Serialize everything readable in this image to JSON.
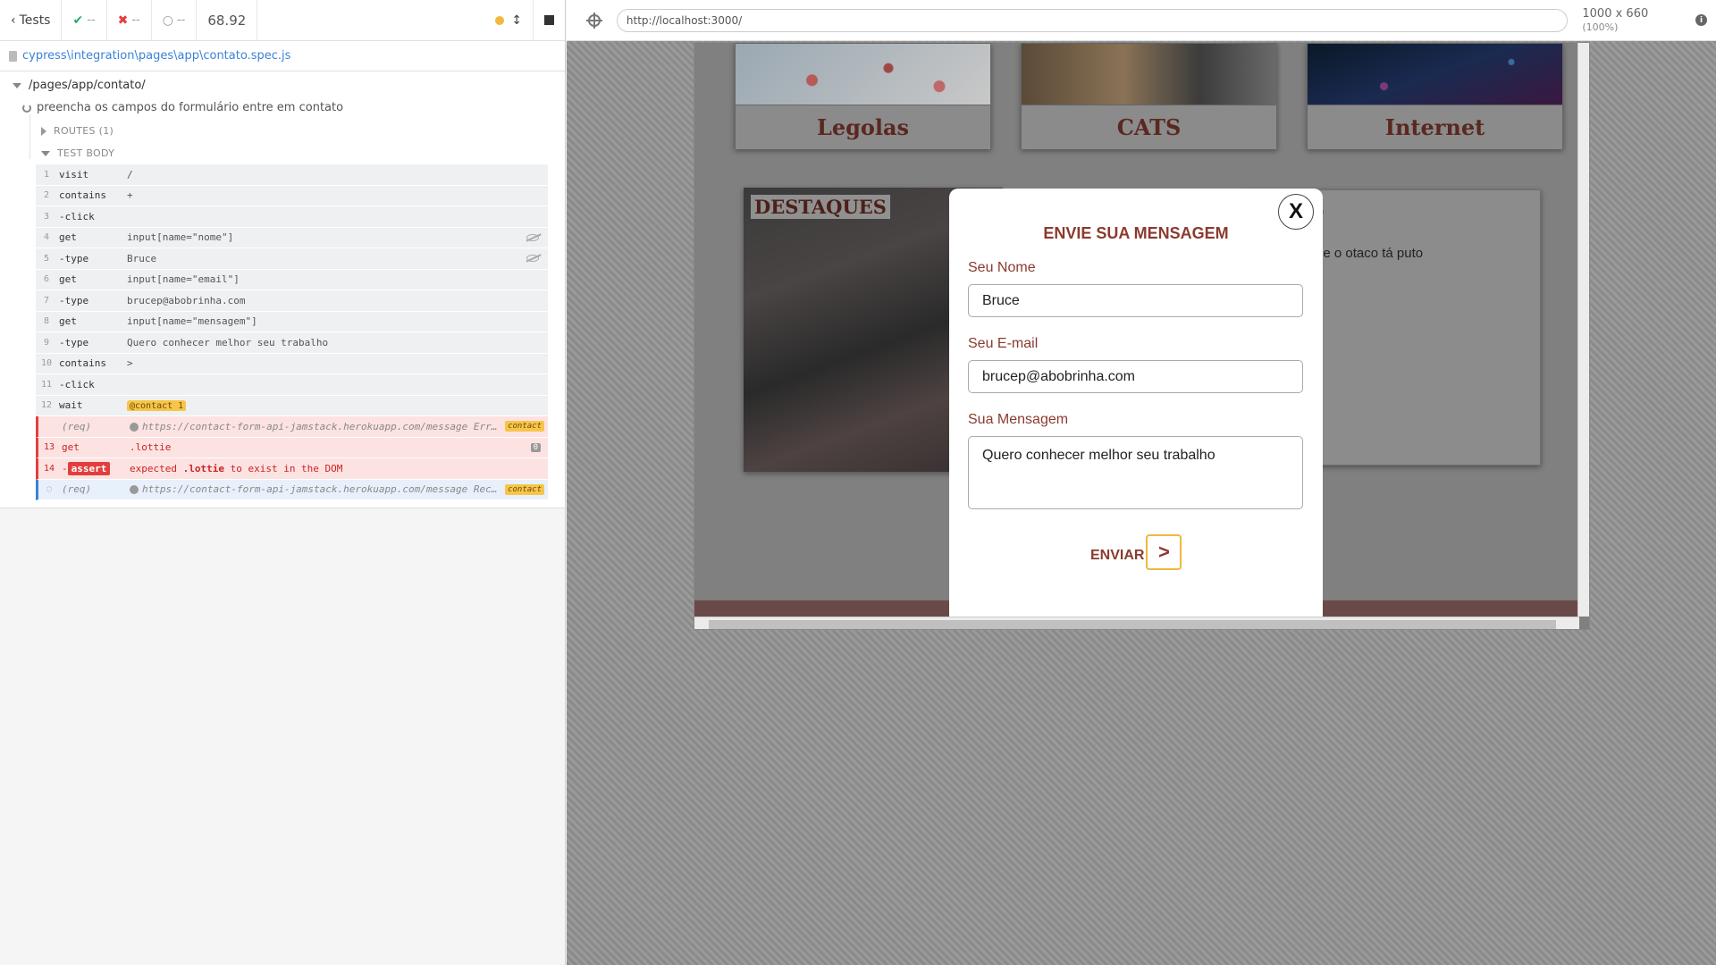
{
  "reporter": {
    "tests_label": "Tests",
    "passed": "--",
    "failed": "--",
    "pending": "--",
    "duration": "68.92",
    "spec_path": "cypress\\integration\\pages\\app\\contato.spec.js",
    "suite": "/pages/app/contato/",
    "test": "preencha os campos do formulário entre em contato",
    "routes_label": "ROUTES (1)",
    "body_label": "TEST BODY",
    "commands": [
      {
        "num": "1",
        "name": "visit",
        "msg": "/"
      },
      {
        "num": "2",
        "name": "contains",
        "msg": "+"
      },
      {
        "num": "3",
        "name": " -click",
        "msg": ""
      },
      {
        "num": "4",
        "name": "get",
        "msg": "input[name=\"nome\"]"
      },
      {
        "num": "5",
        "name": " -type",
        "msg": "Bruce"
      },
      {
        "num": "6",
        "name": "get",
        "msg": "input[name=\"email\"]"
      },
      {
        "num": "7",
        "name": " -type",
        "msg": "brucep@abobrinha.com"
      },
      {
        "num": "8",
        "name": "get",
        "msg": "input[name=\"mensagem\"]"
      },
      {
        "num": "9",
        "name": " -type",
        "msg": "Quero conhecer melhor seu trabalho"
      },
      {
        "num": "10",
        "name": "contains",
        "msg": ">"
      },
      {
        "num": "11",
        "name": " -click",
        "msg": ""
      },
      {
        "num": "12",
        "name": "wait",
        "msg": "@contact 1"
      },
      {
        "num": "",
        "name": "(req)",
        "msg": "https://contact-form-api-jamstack.herokuapp.com/message Err…",
        "alias": "contact"
      },
      {
        "num": "13",
        "name": "get",
        "msg": ".lottie",
        "badge": "0"
      },
      {
        "num": "14",
        "name": "assert",
        "msg_pre": "expected ",
        "msg_bold": ".lottie",
        "msg_post": " to exist in the DOM"
      },
      {
        "num": "",
        "name": "(req)",
        "msg": "https://contact-form-api-jamstack.herokuapp.com/message Rec…",
        "alias": "contact"
      }
    ]
  },
  "aut": {
    "url": "http://localhost:3000/",
    "viewport": "1000 x 660",
    "zoom": "(100%)"
  },
  "site": {
    "cards": [
      "Legolas",
      "CATS",
      "Internet"
    ],
    "destaques": "DESTAQUES",
    "right_text": "ue o otaco tá puto",
    "right_head": "o"
  },
  "modal": {
    "close": "X",
    "title": "ENVIE SUA MENSAGEM",
    "name_label": "Seu Nome",
    "name_value": "Bruce",
    "email_label": "Seu E-mail",
    "email_value": "brucep@abobrinha.com",
    "msg_label": "Sua Mensagem",
    "msg_value": "Quero conhecer melhor seu trabalho",
    "send_label": "ENVIAR",
    "send_arrow": ">"
  },
  "colors": {
    "accent": "#8b3a2e",
    "pass": "#2ca86b",
    "fail": "#e23e3e",
    "alias": "#f7c54a"
  }
}
